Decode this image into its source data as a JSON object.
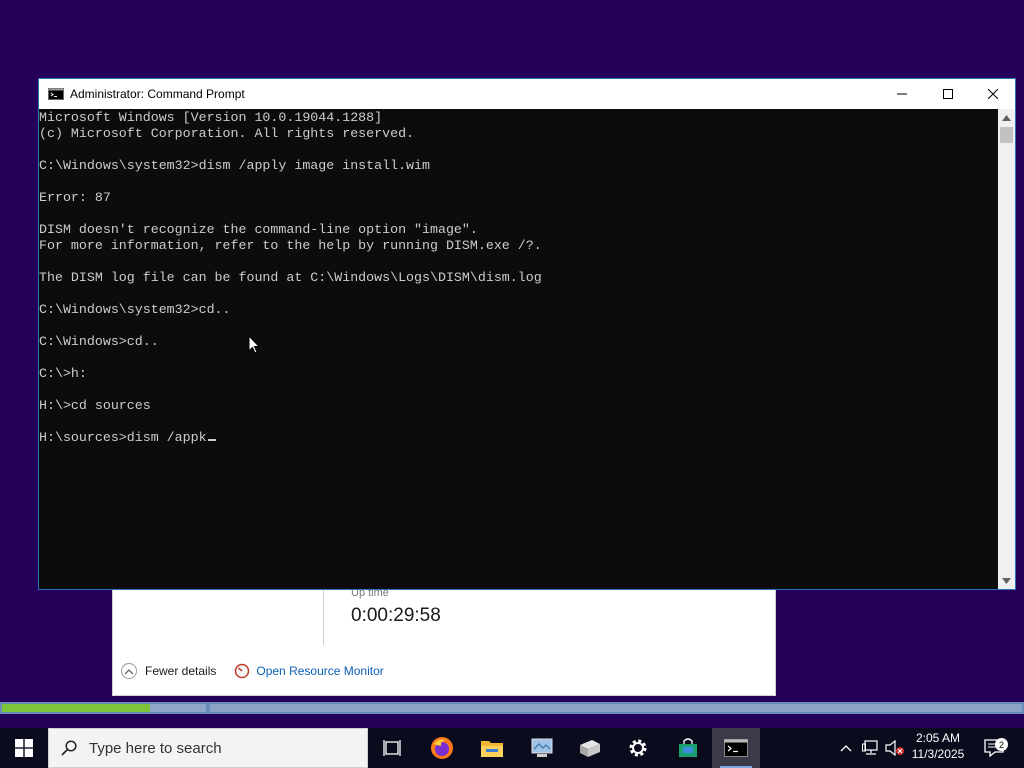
{
  "task_manager": {
    "uptime_label": "Up time",
    "uptime_value": "0:00:29:58",
    "fewer_details": "Fewer details",
    "open_resource_monitor": "Open Resource Monitor"
  },
  "progress": {
    "fill_fraction": 0.145
  },
  "cmd": {
    "title": "Administrator: Command Prompt",
    "lines": [
      "Microsoft Windows [Version 10.0.19044.1288]",
      "(c) Microsoft Corporation. All rights reserved.",
      "",
      "C:\\Windows\\system32>dism /apply image install.wim",
      "",
      "Error: 87",
      "",
      "DISM doesn't recognize the command-line option \"image\".",
      "For more information, refer to the help by running DISM.exe /?.",
      "",
      "The DISM log file can be found at C:\\Windows\\Logs\\DISM\\dism.log",
      "",
      "C:\\Windows\\system32>cd..",
      "",
      "C:\\Windows>cd..",
      "",
      "C:\\>h:",
      "",
      "H:\\>cd sources",
      "",
      "H:\\sources>dism /appk"
    ]
  },
  "taskbar": {
    "search_placeholder": "Type here to search",
    "clock_time": "2:05 AM",
    "clock_date": "11/3/2025",
    "notification_count": "2",
    "icons": [
      "windows-start-icon",
      "search-icon",
      "task-view-icon",
      "firefox-icon",
      "file-explorer-icon",
      "network-drive-icon",
      "server-manager-icon",
      "settings-gear-icon",
      "store-icon",
      "command-prompt-icon"
    ]
  },
  "colors": {
    "desktop": "#24005a",
    "accent": "#2f6fbf",
    "progress_fill": "#7ec43a"
  }
}
